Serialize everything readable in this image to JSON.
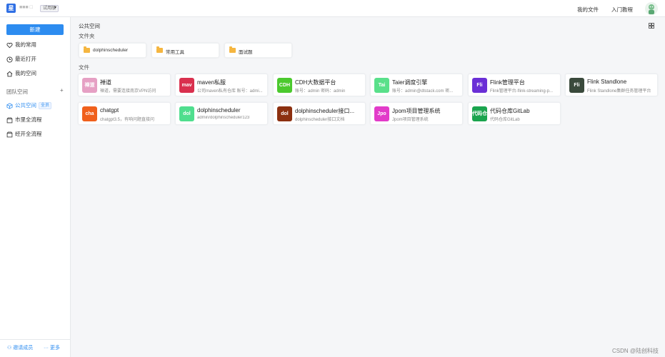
{
  "topbar": {
    "logo_char": "星",
    "org_name": "■■■ □",
    "trial_badge": "试用版",
    "caret": "▾",
    "my_files": "我的文件",
    "tutorial": "入门教程"
  },
  "sidebar": {
    "new_button": "新建",
    "items": [
      {
        "label": "我的常用",
        "icon": "heart-icon"
      },
      {
        "label": "最近打开",
        "icon": "clock-icon"
      },
      {
        "label": "我的空间",
        "icon": "home-icon"
      }
    ],
    "team_section": "团队空间",
    "add": "+",
    "team_items": [
      {
        "label": "公共空间",
        "badge": "全员",
        "icon": "cube-icon"
      },
      {
        "label": "市里全流程",
        "icon": "box-icon"
      },
      {
        "label": "经开全流程",
        "icon": "box-icon"
      }
    ],
    "invite": "邀请成员",
    "more": "更多"
  },
  "main": {
    "breadcrumb": "公共空间",
    "folders_title": "文件夹",
    "files_title": "文件",
    "folders": [
      {
        "name": "dolphinscheduler"
      },
      {
        "name": "常用工具"
      },
      {
        "name": "面试题"
      }
    ],
    "files": [
      {
        "icon_text": "禅道",
        "color": "#e6a0c4",
        "name": "禅道",
        "desc": "禅道，需要连接南京VPN访问"
      },
      {
        "icon_text": "mav",
        "color": "#d9304e",
        "name": "maven私服",
        "desc": "公司maven私有仓库 账号：admi..."
      },
      {
        "icon_text": "CDH",
        "color": "#4bc92e",
        "name": "CDH大数据平台",
        "desc": "账号：admin 密码：admin"
      },
      {
        "icon_text": "Tai",
        "color": "#59e08a",
        "name": "Taier调度引擎",
        "desc": "账号：admin@dtstack.com 密..."
      },
      {
        "icon_text": "Fli",
        "color": "#6a2fd6",
        "name": "Flink管理平台",
        "desc": "Flink管理平台-flink-streaming-p..."
      },
      {
        "icon_text": "Fli",
        "color": "#3a4a3c",
        "name": "Flink Standlone",
        "desc": "Flink Standlone集群任务管理平台"
      },
      {
        "icon_text": "cha",
        "color": "#f0601c",
        "name": "chatgpt",
        "desc": "chatgpt3.5，有响问题直接问"
      },
      {
        "icon_text": "dol",
        "color": "#4fde8e",
        "name": "dolphinscheduler",
        "desc": "admin/dolphinscheduler123"
      },
      {
        "icon_text": "dol",
        "color": "#8c3010",
        "name": "dolphinscheduler接口...",
        "desc": "dolphinscheduler接口文档"
      },
      {
        "icon_text": "Jpo",
        "color": "#e23bc9",
        "name": "Jpom项目管理系统",
        "desc": "Jpom项目管理系统"
      },
      {
        "icon_text": "代码仓",
        "color": "#1aa44e",
        "name": "代码仓库GitLab",
        "desc": "代码仓库GitLab"
      }
    ]
  },
  "watermark": "CSDN @陆创科技"
}
